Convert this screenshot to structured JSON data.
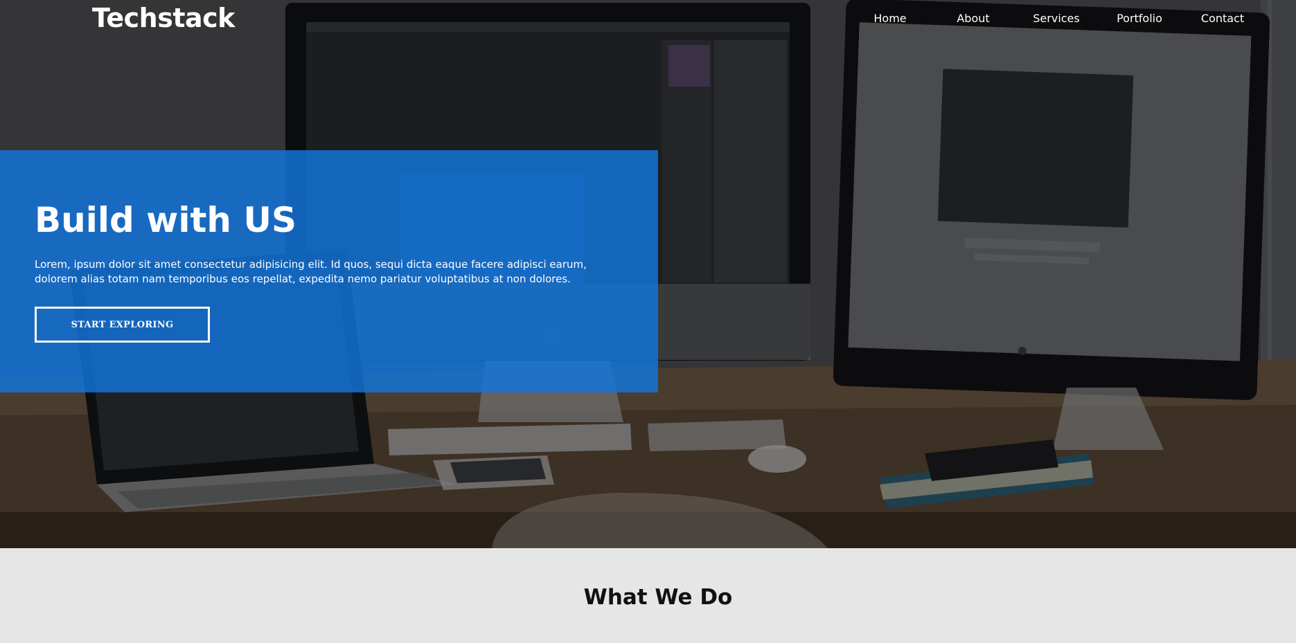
{
  "brand": {
    "logo_text": "Techstack"
  },
  "nav": {
    "items": [
      {
        "label": "Home"
      },
      {
        "label": "About"
      },
      {
        "label": "Services"
      },
      {
        "label": "Portfolio"
      },
      {
        "label": "Contact"
      }
    ]
  },
  "hero": {
    "title": "Build with US",
    "description": "Lorem, ipsum dolor sit amet consectetur adipisicing elit. Id quos, sequi dicta eaque facere adipisci earum, dolorem alias totam nam temporibus eos repellat, expedita nemo pariatur voluptatibus at non dolores.",
    "cta_label": "START EXPLORING",
    "panel_color": "#1276de"
  },
  "section": {
    "title": "What We Do"
  }
}
